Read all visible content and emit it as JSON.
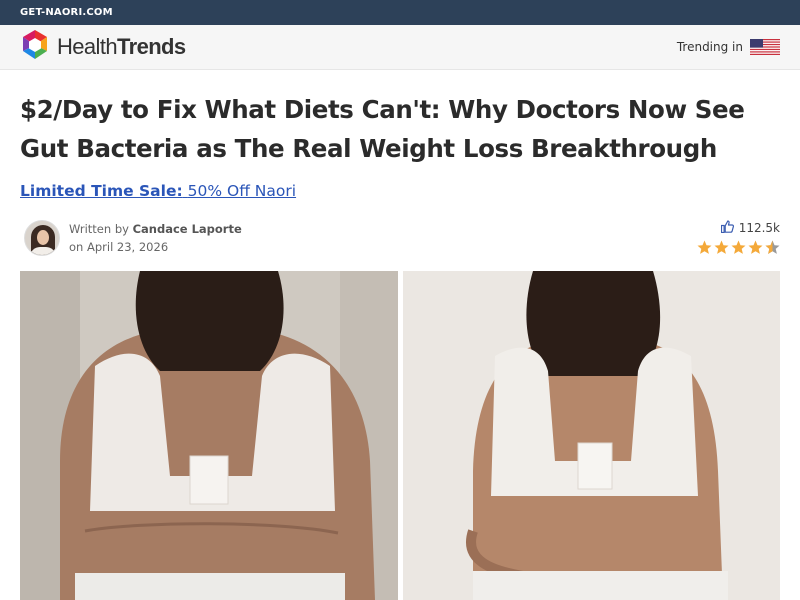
{
  "topbar": {
    "site_link": "GET-NAORI.COM"
  },
  "header": {
    "brand_part1": "Health",
    "brand_part2": "Trends",
    "trending_label": "Trending in"
  },
  "article": {
    "headline": "$2/Day to Fix What Diets Can't: Why Doctors Now See Gut Bacteria as The Real Weight Loss Breakthrough",
    "promo_strong": "Limited Time Sale:",
    "promo_rest": "50% Off Naori",
    "written_by": "Written by",
    "author": "Candace Laporte",
    "date": "on April 23, 2026",
    "likes": "112.5k",
    "rating": 4.5
  },
  "colors": {
    "topbar": "#2d4159",
    "link": "#2a55b8",
    "star": "#f4a93a"
  },
  "icons": [
    "logo-icon",
    "us-flag-icon",
    "thumbs-up-icon",
    "star-icon"
  ]
}
